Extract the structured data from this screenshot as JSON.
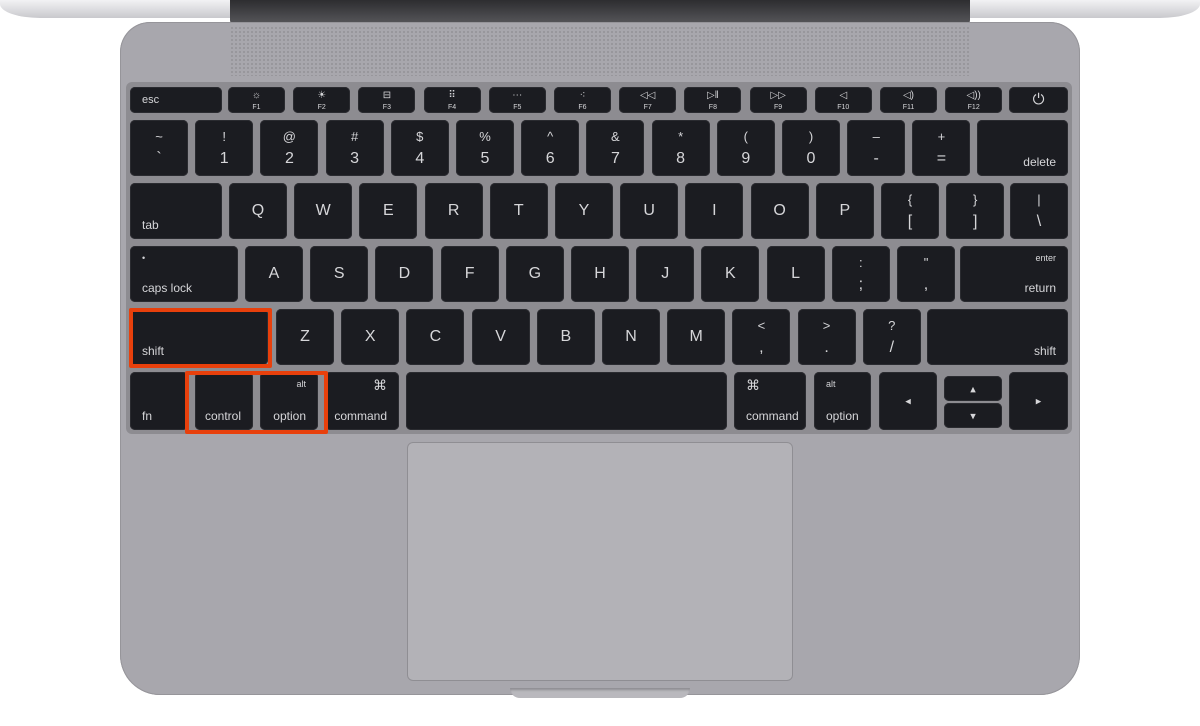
{
  "function_row": [
    {
      "label": "esc"
    },
    {
      "label": "F1",
      "icon": "brightness-down-icon"
    },
    {
      "label": "F2",
      "icon": "brightness-up-icon"
    },
    {
      "label": "F3",
      "icon": "mission-control-icon"
    },
    {
      "label": "F4",
      "icon": "launchpad-icon"
    },
    {
      "label": "F5",
      "icon": "keyboard-backlight-down-icon"
    },
    {
      "label": "F6",
      "icon": "keyboard-backlight-up-icon"
    },
    {
      "label": "F7",
      "icon": "rewind-icon"
    },
    {
      "label": "F8",
      "icon": "play-pause-icon"
    },
    {
      "label": "F9",
      "icon": "fast-forward-icon"
    },
    {
      "label": "F10",
      "icon": "mute-icon"
    },
    {
      "label": "F11",
      "icon": "volume-down-icon"
    },
    {
      "label": "F12",
      "icon": "volume-up-icon"
    },
    {
      "icon": "power-icon"
    }
  ],
  "number_row": [
    {
      "top": "~",
      "bottom": "`"
    },
    {
      "top": "!",
      "bottom": "1"
    },
    {
      "top": "@",
      "bottom": "2"
    },
    {
      "top": "#",
      "bottom": "3"
    },
    {
      "top": "$",
      "bottom": "4"
    },
    {
      "top": "%",
      "bottom": "5"
    },
    {
      "top": "^",
      "bottom": "6"
    },
    {
      "top": "&",
      "bottom": "7"
    },
    {
      "top": "*",
      "bottom": "8"
    },
    {
      "top": "(",
      "bottom": "9"
    },
    {
      "top": ")",
      "bottom": "0"
    },
    {
      "top": "–",
      "bottom": "-"
    },
    {
      "top": "+",
      "bottom": "="
    },
    {
      "mod": "delete",
      "side": "r"
    }
  ],
  "q_row": [
    {
      "mod": "tab",
      "side": "l"
    },
    {
      "letter": "Q"
    },
    {
      "letter": "W"
    },
    {
      "letter": "E"
    },
    {
      "letter": "R"
    },
    {
      "letter": "T"
    },
    {
      "letter": "Y"
    },
    {
      "letter": "U"
    },
    {
      "letter": "I"
    },
    {
      "letter": "O"
    },
    {
      "letter": "P"
    },
    {
      "top": "{",
      "bottom": "["
    },
    {
      "top": "}",
      "bottom": "]"
    },
    {
      "top": "|",
      "bottom": "\\"
    }
  ],
  "a_row": [
    {
      "mod": "caps lock",
      "side": "l",
      "modtop": "•"
    },
    {
      "letter": "A"
    },
    {
      "letter": "S"
    },
    {
      "letter": "D"
    },
    {
      "letter": "F"
    },
    {
      "letter": "G"
    },
    {
      "letter": "H"
    },
    {
      "letter": "J"
    },
    {
      "letter": "K"
    },
    {
      "letter": "L"
    },
    {
      "top": ":",
      "bottom": ";"
    },
    {
      "top": "\"",
      "bottom": ","
    },
    {
      "mod": "return",
      "side": "r",
      "modtop": "enter"
    }
  ],
  "z_row": [
    {
      "mod": "shift",
      "side": "l"
    },
    {
      "letter": "Z"
    },
    {
      "letter": "X"
    },
    {
      "letter": "C"
    },
    {
      "letter": "V"
    },
    {
      "letter": "B"
    },
    {
      "letter": "N"
    },
    {
      "letter": "M"
    },
    {
      "top": "<",
      "bottom": ","
    },
    {
      "top": ">",
      "bottom": "."
    },
    {
      "top": "?",
      "bottom": "/"
    },
    {
      "mod": "shift",
      "side": "r"
    }
  ],
  "bottom_row": [
    {
      "mod": "fn",
      "side": "l"
    },
    {
      "mod": "control",
      "side": "r"
    },
    {
      "mod": "option",
      "side": "r",
      "modtop": "alt"
    },
    {
      "mod": "command",
      "side": "r",
      "modtop": "⌘"
    },
    {
      "name": "space"
    },
    {
      "mod": "command",
      "side": "l",
      "modtop": "⌘"
    },
    {
      "mod": "option",
      "side": "l",
      "modtop": "alt"
    },
    {
      "icon": "arrow-left-icon",
      "glyph": "◂"
    },
    {
      "icon": "arrow-up-icon",
      "glyph": "▴"
    },
    {
      "icon": "arrow-down-icon",
      "glyph": "▾"
    },
    {
      "icon": "arrow-right-icon",
      "glyph": "▸"
    }
  ],
  "highlighted_keys": [
    "shift",
    "control",
    "option"
  ],
  "highlight_color": "#e8400c"
}
